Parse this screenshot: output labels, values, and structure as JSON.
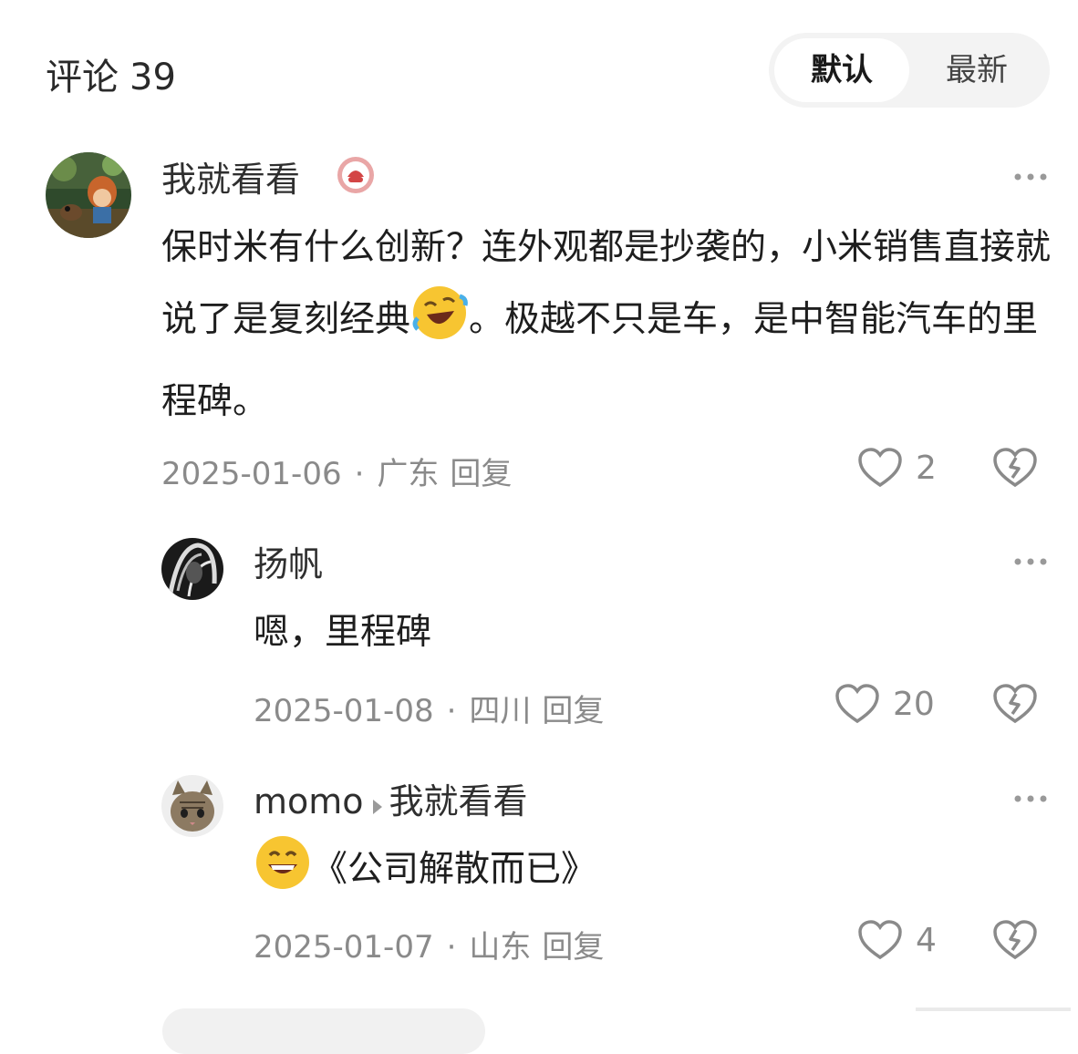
{
  "header": {
    "title": "评论",
    "count": "39",
    "sort_default": "默认",
    "sort_latest": "最新"
  },
  "comments": [
    {
      "user": "我就看看",
      "content_before_emoji": "保时米有什么创新？连外观都是抄袭的，小米销售直接就说了是复刻经典",
      "content_after_emoji": "。极越不只是车，是中智能汽车的里程碑。",
      "date": "2025-01-06",
      "location": "广东",
      "reply_label": "回复",
      "likes": "2"
    },
    {
      "user": "扬帆",
      "content": "嗯，里程碑",
      "date": "2025-01-08",
      "location": "四川",
      "reply_label": "回复",
      "likes": "20"
    },
    {
      "user": "momo",
      "reply_to": "我就看看",
      "content": "《公司解散而已》",
      "date": "2025-01-07",
      "location": "山东",
      "reply_label": "回复",
      "likes": "4"
    }
  ],
  "icons": {
    "more": "more-dots-icon",
    "like": "heart-outline-icon",
    "dislike": "broken-heart-icon",
    "emoji_laugh": "rolling-laughing-emoji",
    "emoji_smile": "grinning-emoji",
    "badge": "user-badge-icon",
    "reply_arrow": "reply-arrow-icon"
  },
  "colors": {
    "text_primary": "#1e1e1e",
    "text_secondary": "#8a8a8a",
    "toggle_bg": "#f3f3f3"
  }
}
